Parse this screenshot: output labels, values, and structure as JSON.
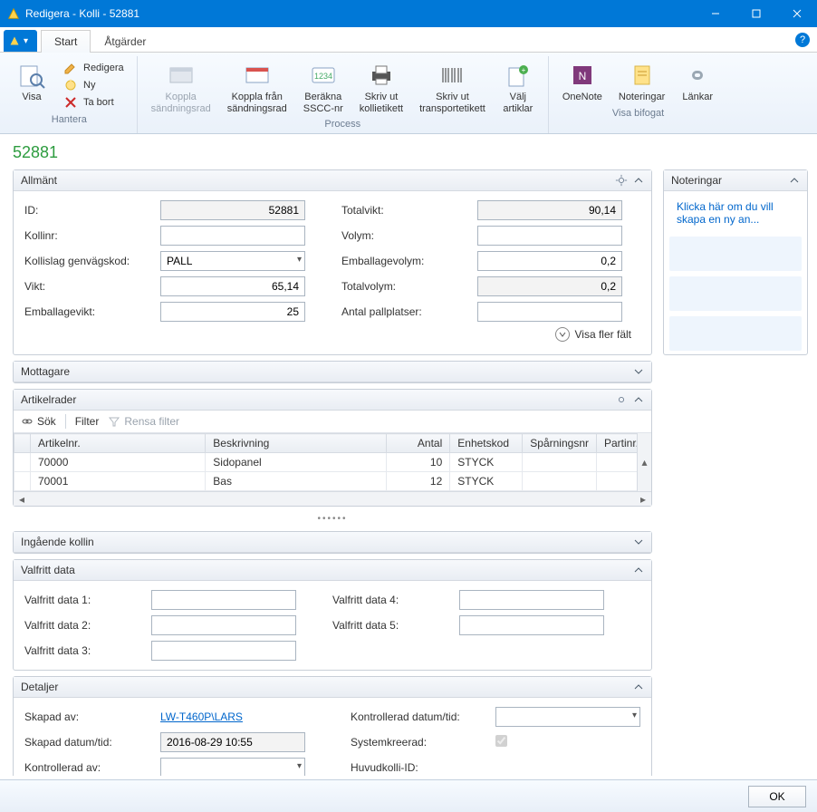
{
  "window": {
    "title": "Redigera - Kolli - 52881"
  },
  "ribbon": {
    "tabs": {
      "start": "Start",
      "actions": "Åtgärder"
    },
    "hantera": {
      "label": "Hantera",
      "visa": "Visa",
      "redigera": "Redigera",
      "ny": "Ny",
      "ta_bort": "Ta bort"
    },
    "process": {
      "label": "Process",
      "koppla": "Koppla\nsändningsrad",
      "koppla_fran": "Koppla från\nsändningsrad",
      "berakna": "Beräkna\nSSCC-nr",
      "skriv_kolli": "Skriv ut\nkollietikett",
      "skriv_transport": "Skriv ut\ntransportetikett",
      "valj": "Välj\nartiklar"
    },
    "visa_bifogat": {
      "label": "Visa bifogat",
      "onenote": "OneNote",
      "noteringar": "Noteringar",
      "lankar": "Länkar"
    }
  },
  "page_title": "52881",
  "allmant": {
    "title": "Allmänt",
    "id_label": "ID:",
    "id_value": "52881",
    "kollinr_label": "Kollinr:",
    "kollinr_value": "",
    "kollislag_label": "Kollislag genvägskod:",
    "kollislag_value": "PALL",
    "vikt_label": "Vikt:",
    "vikt_value": "65,14",
    "emballagevikt_label": "Emballagevikt:",
    "emballagevikt_value": "25",
    "totalvikt_label": "Totalvikt:",
    "totalvikt_value": "90,14",
    "volym_label": "Volym:",
    "volym_value": "",
    "emballagevolym_label": "Emballagevolym:",
    "emballagevolym_value": "0,2",
    "totalvolym_label": "Totalvolym:",
    "totalvolym_value": "0,2",
    "pallplatser_label": "Antal pallplatser:",
    "pallplatser_value": "",
    "show_more": "Visa fler fält"
  },
  "mottagare_title": "Mottagare",
  "artikelrader": {
    "title": "Artikelrader",
    "toolbar": {
      "sok": "Sök",
      "filter": "Filter",
      "rensa": "Rensa filter"
    },
    "columns": {
      "artikelnr": "Artikelnr.",
      "beskrivning": "Beskrivning",
      "antal": "Antal",
      "enhetskod": "Enhetskod",
      "sparning": "Spårningsnr",
      "partinr": "Partinr."
    },
    "rows": [
      {
        "artikelnr": "70000",
        "beskrivning": "Sidopanel",
        "antal": "10",
        "enhetskod": "STYCK",
        "sparning": "",
        "partinr": ""
      },
      {
        "artikelnr": "70001",
        "beskrivning": "Bas",
        "antal": "12",
        "enhetskod": "STYCK",
        "sparning": "",
        "partinr": ""
      }
    ]
  },
  "ingaende_title": "Ingående kollin",
  "valfritt": {
    "title": "Valfritt data",
    "d1": "Valfritt data 1:",
    "d2": "Valfritt data 2:",
    "d3": "Valfritt data 3:",
    "d4": "Valfritt data 4:",
    "d5": "Valfritt data 5:"
  },
  "detaljer": {
    "title": "Detaljer",
    "skapad_av_label": "Skapad av:",
    "skapad_av_value": "LW-T460P\\LARS",
    "skapad_datum_label": "Skapad datum/tid:",
    "skapad_datum_value": "2016-08-29 10:55",
    "kontrollerad_av_label": "Kontrollerad av:",
    "kontrollerad_av_value": "",
    "kontrollerad_datum_label": "Kontrollerad datum/tid:",
    "kontrollerad_datum_value": "",
    "systemkreerad_label": "Systemkreerad:",
    "huvudkolli_label": "Huvudkolli-ID:"
  },
  "noteringar": {
    "title": "Noteringar",
    "link": "Klicka här om du vill skapa en ny an..."
  },
  "ok": "OK"
}
